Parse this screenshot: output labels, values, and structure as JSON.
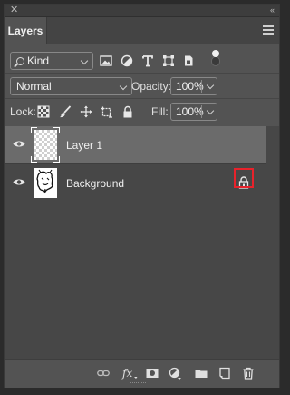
{
  "panel": {
    "tab_label": "Layers",
    "close_glyph": "✕",
    "collapse_glyph": "‹‹"
  },
  "filter": {
    "kind_label": "Kind",
    "icons": [
      "image-filter-icon",
      "adjustment-filter-icon",
      "type-filter-icon",
      "shape-filter-icon",
      "smart-object-filter-icon"
    ],
    "filter_toggle": "on"
  },
  "blend": {
    "mode": "Normal",
    "opacity_label": "Opacity:",
    "opacity_value": "100%"
  },
  "lock": {
    "label": "Lock:",
    "icons": [
      "lock-transparent-pixels-icon",
      "lock-image-pixels-icon",
      "lock-position-icon",
      "prevent-auto-nesting-icon",
      "lock-all-icon"
    ],
    "fill_label": "Fill:",
    "fill_value": "100%"
  },
  "layers": [
    {
      "name": "Layer 1",
      "visible": true,
      "selected": true,
      "thumbnail": "transparent"
    },
    {
      "name": "Background",
      "visible": true,
      "selected": false,
      "thumbnail": "sketch",
      "locked": true
    }
  ],
  "footer_icons": [
    "link-layers-icon",
    "fx-icon",
    "add-mask-icon",
    "new-adjustment-layer-icon",
    "new-group-icon",
    "new-layer-icon",
    "trash-icon"
  ],
  "colors": {
    "panel_bg": "#535353",
    "layers_bg": "#474747",
    "selected_row": "#6b6b6b",
    "highlight": "#e8222b"
  }
}
